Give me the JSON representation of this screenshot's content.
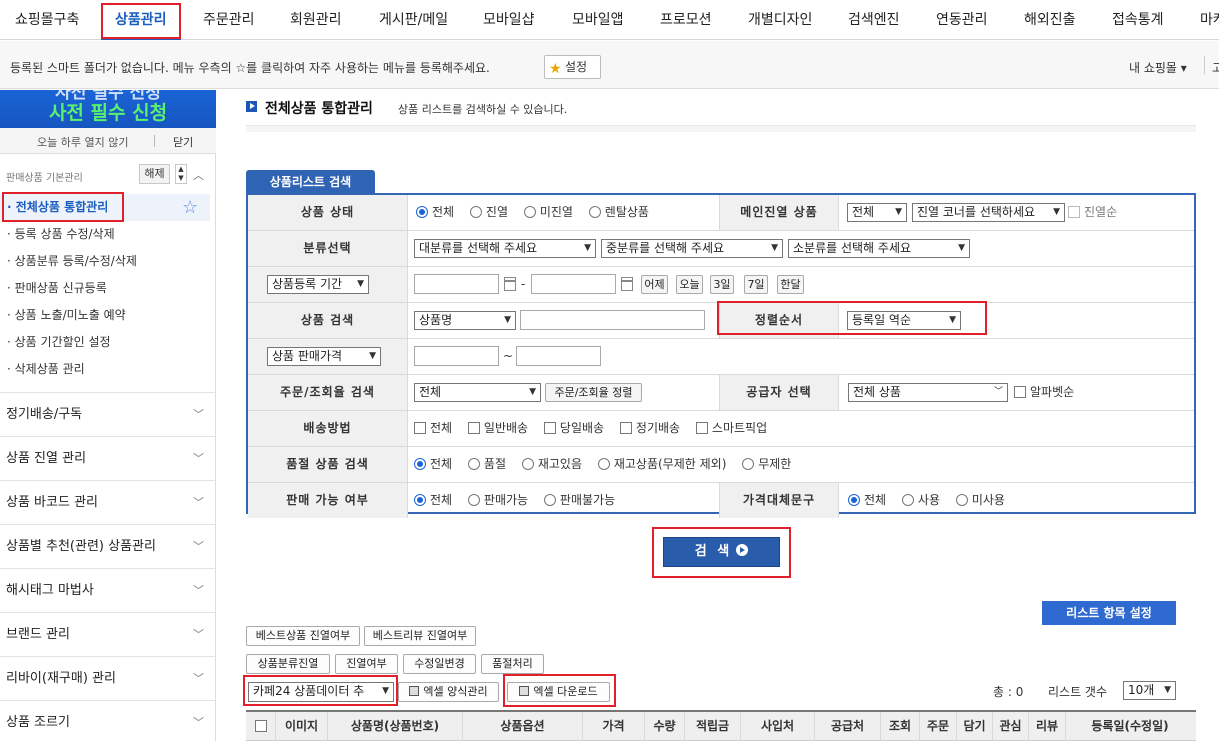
{
  "topnav": [
    "쇼핑몰구축",
    "상품관리",
    "주문관리",
    "회원관리",
    "게시판/메일",
    "모바일샵",
    "모바일앱",
    "프로모션",
    "개별디자인",
    "검색엔진",
    "연동관리",
    "해외진출",
    "접속통계",
    "마케"
  ],
  "favbar": {
    "message": "등록된 스마트 폴더가 없습니다. 메뉴 우측의 ☆를 클릭하여 자주 사용하는 메뉴를 등록해주세요.",
    "settings_label": "설정",
    "my_shop": "내 쇼핑몰 ▾",
    "more": "고"
  },
  "sidebar": {
    "banner_line1": "사전 필수 신청",
    "banner_line2": "사전 필수 신청",
    "not_today": "오늘 하루 열지 않기",
    "close": "닫기",
    "group_title": "판매상품 기본관리",
    "release": "해제",
    "sub_items": [
      "· 전체상품 통합관리",
      "· 등록 상품 수정/삭제",
      "· 상품분류 등록/수정/삭제",
      "· 판매상품 신규등록",
      "· 상품 노출/미노출 예약",
      "· 상품 기간할인 설정",
      "· 삭제상품 관리"
    ],
    "sections": [
      "정기배송/구독",
      "상품 진열 관리",
      "상품 바코드 관리",
      "상품별 추천(관련) 상품관리",
      "해시태그 마법사",
      "브랜드 관리",
      "리바이(재구매) 관리",
      "상품 조르기"
    ]
  },
  "main": {
    "title": "전체상품 통합관리",
    "desc": "상품 리스트를 검색하실 수 있습니다.",
    "search_tab": "상품리스트 검색",
    "rows": {
      "status_label": "상품 상태",
      "status_opts": [
        "전체",
        "진열",
        "미진열",
        "렌탈상품"
      ],
      "main_display_label": "메인진열 상품",
      "main_display_sel": "전체",
      "corner_sel": "진열 코너를 선택하세요",
      "display_order": "진열순",
      "category_label": "분류선택",
      "cat1": "대분류를 선택해 주세요",
      "cat2": "중분류를 선택해 주세요",
      "cat3": "소분류를 선택해 주세요",
      "period_sel": "상품등록 기간",
      "date_btns": [
        "어제",
        "오늘",
        "3일",
        "7일",
        "한달"
      ],
      "product_search_label": "상품 검색",
      "product_search_sel": "상품명",
      "sort_label": "정렬순서",
      "sort_sel": "등록일 역순",
      "price_sel": "상품 판매가격",
      "order_search_label": "주문/조회율 검색",
      "order_search_sel": "전체",
      "order_sort_btn": "주문/조회율 정렬",
      "supplier_label": "공급자 선택",
      "supplier_sel": "전체 상품",
      "alpha_order": "알파벳순",
      "shipping_label": "배송방법",
      "shipping_opts": [
        "전체",
        "일반배송",
        "당일배송",
        "정기배송",
        "스마트픽업"
      ],
      "soldout_label": "품절 상품 검색",
      "soldout_opts": [
        "전체",
        "품절",
        "재고있음",
        "재고상품(무제한 제외)",
        "무제한"
      ],
      "sale_label": "판매 가능 여부",
      "sale_opts": [
        "전체",
        "판매가능",
        "판매불가능"
      ],
      "price_sub_label": "가격대체문구",
      "price_sub_opts": [
        "전체",
        "사용",
        "미사용"
      ]
    },
    "search_btn": "검 색",
    "list_setting": "리스트 항목 설정",
    "btn_row1": [
      "베스트상품 진열여부",
      "베스트리뷰 진열여부"
    ],
    "btn_row2": [
      "상품분류진열",
      "진열여부",
      "수정일변경",
      "품절처리"
    ],
    "data_sel": "카페24 상품데이터 추",
    "excel_form": "엑셀 양식관리",
    "excel_download": "엑셀 다운로드",
    "total": "총 : 0",
    "list_count_label": "리스트 갯수",
    "list_count_sel": "10개",
    "table_headers": [
      "",
      "이미지",
      "상품명(상품번호)",
      "상품옵션",
      "가격",
      "수량",
      "적립금",
      "사입처",
      "공급처",
      "조회",
      "주문",
      "담기",
      "관심",
      "리뷰",
      "등록일(수정일)"
    ]
  }
}
